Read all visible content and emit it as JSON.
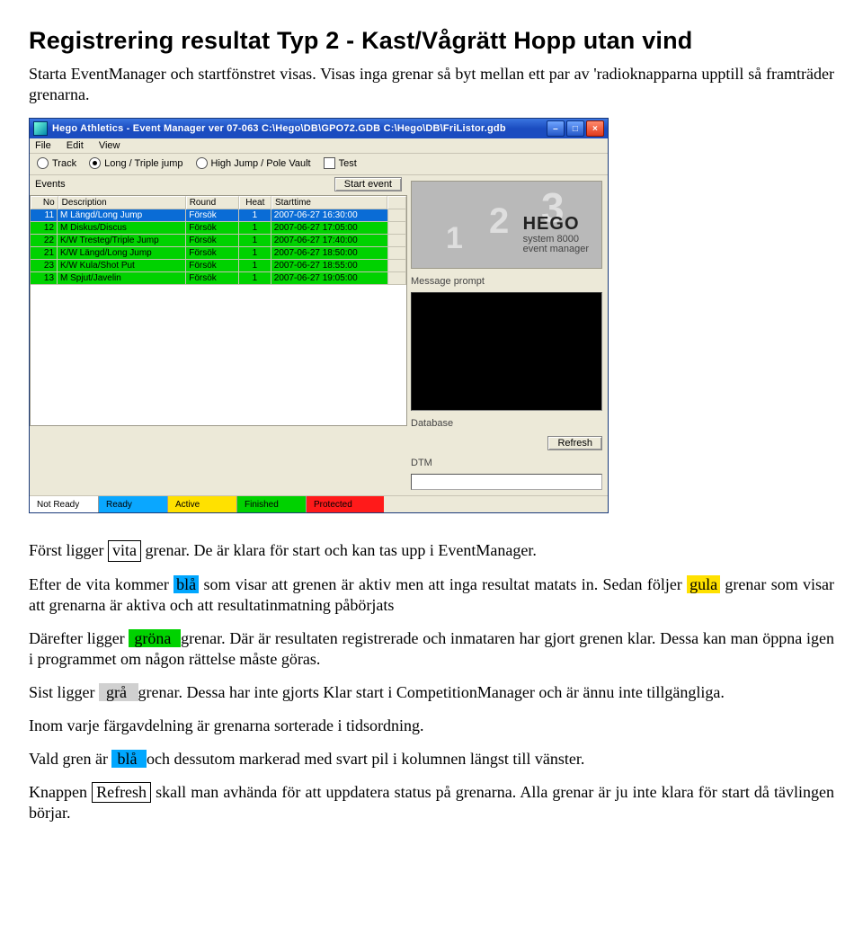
{
  "doc": {
    "title": "Registrering resultat Typ 2 - Kast/Vågrätt Hopp utan vind",
    "intro": "Starta EventManager och startfönstret visas. Visas inga grenar så byt mellan ett par av 'radioknapparna upptill så framträder grenarna.",
    "p_first_a": "Först ligger ",
    "p_first_box": "vita",
    "p_first_b": " grenar. De är klara för start och kan tas upp i EventManager.",
    "p_blue_a": "Efter de vita kommer ",
    "p_blue_hl": "blå",
    "p_blue_b": " som visar att grenen är aktiv men att inga resultat matats in. Sedan följer ",
    "p_yellow_hl": "gula",
    "p_blue_c": " grenar som visar att grenarna är aktiva och att resultatinmatning påbörjats",
    "p_green_a": "Därefter ligger ",
    "p_green_hl": " gröna ",
    "p_green_b": " grenar. Där är resultaten registrerade och inmataren har gjort grenen klar. Dessa kan man öppna igen i programmet om någon rättelse måste göras.",
    "p_grey_a": "Sist ligger ",
    "p_grey_hl": " grå ",
    "p_grey_b": " grenar. Dessa har inte gjorts Klar start i CompetitionManager och är ännu inte tillgängliga.",
    "p_sort": "Inom varje färgavdelning är grenarna sorterade i tidsordning.",
    "p_sel_a": "Vald gren är ",
    "p_sel_hl": " blå ",
    "p_sel_b": " och dessutom markerad med svart pil i kolumnen längst till vänster.",
    "p_refresh_a": "Knappen ",
    "p_refresh_box": "Refresh",
    "p_refresh_b": " skall man avhända för att uppdatera status på grenarna. Alla grenar är ju inte klara för start då tävlingen börjar."
  },
  "win": {
    "title": "Hego Athletics - Event Manager ver 07-063  C:\\Hego\\DB\\GPO72.GDB C:\\Hego\\DB\\FriListor.gdb",
    "menu": {
      "file": "File",
      "edit": "Edit",
      "view": "View"
    },
    "radios": {
      "track": "Track",
      "long": "Long / Triple jump",
      "high": "High Jump / Pole Vault",
      "test": "Test"
    },
    "events_label": "Events",
    "start_event": "Start event",
    "cols": {
      "no": "No",
      "desc": "Description",
      "round": "Round",
      "heat": "Heat",
      "start": "Starttime"
    },
    "rows": [
      {
        "no": "11",
        "desc": "M Längd/Long Jump",
        "round": "Försök",
        "heat": "1",
        "start": "2007-06-27 16:30:00",
        "sel": true
      },
      {
        "no": "12",
        "desc": "M Diskus/Discus",
        "round": "Försök",
        "heat": "1",
        "start": "2007-06-27 17:05:00"
      },
      {
        "no": "22",
        "desc": "K/W Tresteg/Triple Jump",
        "round": "Försök",
        "heat": "1",
        "start": "2007-06-27 17:40:00"
      },
      {
        "no": "21",
        "desc": "K/W Längd/Long Jump",
        "round": "Försök",
        "heat": "1",
        "start": "2007-06-27 18:50:00"
      },
      {
        "no": "23",
        "desc": "K/W Kula/Shot Put",
        "round": "Försök",
        "heat": "1",
        "start": "2007-06-27 18:55:00"
      },
      {
        "no": "13",
        "desc": "M Spjut/Javelin",
        "round": "Försök",
        "heat": "1",
        "start": "2007-06-27 19:05:00"
      }
    ],
    "brand": {
      "name": "HEGO",
      "sub1": "system 8000",
      "sub2": "event manager"
    },
    "nums": {
      "n1": "1",
      "n2": "2",
      "n3": "3"
    },
    "labels": {
      "msg": "Message prompt",
      "db": "Database",
      "dtm": "DTM",
      "refresh": "Refresh"
    },
    "status": {
      "notready": "Not Ready",
      "ready": "Ready",
      "active": "Active",
      "finished": "Finished",
      "protected": "Protected"
    }
  }
}
